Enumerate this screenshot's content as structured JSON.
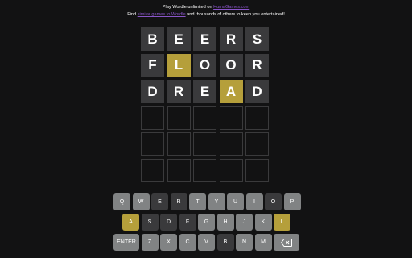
{
  "header": {
    "line1_prefix": "Play Wordle unlimited on",
    "line1_link": "HumaGames.com",
    "line2_prefix": "Find",
    "line2_link": "similar games to Wordle",
    "line2_suffix": "and thousands of others to keep you entertained!"
  },
  "board": {
    "rows": [
      [
        {
          "letter": "B",
          "state": "absent"
        },
        {
          "letter": "E",
          "state": "absent"
        },
        {
          "letter": "E",
          "state": "absent"
        },
        {
          "letter": "R",
          "state": "absent"
        },
        {
          "letter": "S",
          "state": "absent"
        }
      ],
      [
        {
          "letter": "F",
          "state": "absent"
        },
        {
          "letter": "L",
          "state": "present"
        },
        {
          "letter": "O",
          "state": "absent"
        },
        {
          "letter": "O",
          "state": "absent"
        },
        {
          "letter": "R",
          "state": "absent"
        }
      ],
      [
        {
          "letter": "D",
          "state": "absent"
        },
        {
          "letter": "R",
          "state": "absent"
        },
        {
          "letter": "E",
          "state": "absent"
        },
        {
          "letter": "A",
          "state": "present"
        },
        {
          "letter": "D",
          "state": "absent"
        }
      ],
      [
        {
          "letter": "",
          "state": "empty"
        },
        {
          "letter": "",
          "state": "empty"
        },
        {
          "letter": "",
          "state": "empty"
        },
        {
          "letter": "",
          "state": "empty"
        },
        {
          "letter": "",
          "state": "empty"
        }
      ],
      [
        {
          "letter": "",
          "state": "empty"
        },
        {
          "letter": "",
          "state": "empty"
        },
        {
          "letter": "",
          "state": "empty"
        },
        {
          "letter": "",
          "state": "empty"
        },
        {
          "letter": "",
          "state": "empty"
        }
      ],
      [
        {
          "letter": "",
          "state": "empty"
        },
        {
          "letter": "",
          "state": "empty"
        },
        {
          "letter": "",
          "state": "empty"
        },
        {
          "letter": "",
          "state": "empty"
        },
        {
          "letter": "",
          "state": "empty"
        }
      ]
    ]
  },
  "keyboard": {
    "rows": [
      [
        {
          "label": "Q",
          "state": "unused"
        },
        {
          "label": "W",
          "state": "unused"
        },
        {
          "label": "E",
          "state": "absent"
        },
        {
          "label": "R",
          "state": "absent"
        },
        {
          "label": "T",
          "state": "unused"
        },
        {
          "label": "Y",
          "state": "unused"
        },
        {
          "label": "U",
          "state": "unused"
        },
        {
          "label": "I",
          "state": "unused"
        },
        {
          "label": "O",
          "state": "absent"
        },
        {
          "label": "P",
          "state": "unused"
        }
      ],
      [
        {
          "label": "A",
          "state": "present"
        },
        {
          "label": "S",
          "state": "absent"
        },
        {
          "label": "D",
          "state": "absent"
        },
        {
          "label": "F",
          "state": "absent"
        },
        {
          "label": "G",
          "state": "unused"
        },
        {
          "label": "H",
          "state": "unused"
        },
        {
          "label": "J",
          "state": "unused"
        },
        {
          "label": "K",
          "state": "unused"
        },
        {
          "label": "L",
          "state": "present"
        }
      ],
      [
        {
          "label": "ENTER",
          "state": "unused",
          "wide": true
        },
        {
          "label": "Z",
          "state": "unused"
        },
        {
          "label": "X",
          "state": "unused"
        },
        {
          "label": "C",
          "state": "unused"
        },
        {
          "label": "V",
          "state": "unused"
        },
        {
          "label": "B",
          "state": "absent"
        },
        {
          "label": "N",
          "state": "unused"
        },
        {
          "label": "M",
          "state": "unused"
        },
        {
          "label": "",
          "icon": "backspace-icon",
          "state": "unused",
          "wide": true
        }
      ]
    ]
  },
  "colors": {
    "background": "#121213",
    "absent": "#3a3a3c",
    "present": "#b59f3b",
    "correct": "#538d4e",
    "unused_key": "#818384",
    "link": "#8a55c9"
  }
}
